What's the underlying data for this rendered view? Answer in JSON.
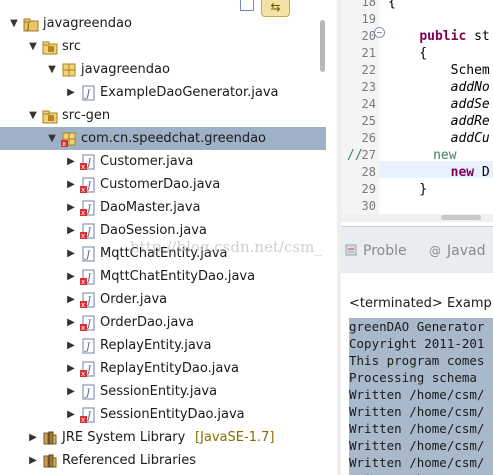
{
  "explorer": {
    "toolbar": {
      "collapse_icon": "collapse-all-icon",
      "link_icon": "link-with-editor-icon"
    },
    "rows": [
      {
        "label": "javagreendao",
        "icon": "java-project-icon",
        "twisty": "▼"
      },
      {
        "label": "src",
        "icon": "source-folder-icon",
        "twisty": "▼"
      },
      {
        "label": "javagreendao",
        "icon": "package-icon",
        "twisty": "▼"
      },
      {
        "label": "ExampleDaoGenerator.java",
        "icon": "java-file-icon",
        "twisty": "▶"
      },
      {
        "label": "src-gen",
        "icon": "source-folder-icon",
        "twisty": "▼"
      },
      {
        "label": "com.cn.speedchat.greendao",
        "icon": "package-error-icon",
        "twisty": "▼"
      },
      {
        "label": "Customer.java",
        "icon": "java-file-error-icon",
        "twisty": "▶"
      },
      {
        "label": "CustomerDao.java",
        "icon": "java-file-error-icon",
        "twisty": "▶"
      },
      {
        "label": "DaoMaster.java",
        "icon": "java-file-error-icon",
        "twisty": "▶"
      },
      {
        "label": "DaoSession.java",
        "icon": "java-file-error-icon",
        "twisty": "▶"
      },
      {
        "label": "MqttChatEntity.java",
        "icon": "java-file-icon",
        "twisty": "▶"
      },
      {
        "label": "MqttChatEntityDao.java",
        "icon": "java-file-error-icon",
        "twisty": "▶"
      },
      {
        "label": "Order.java",
        "icon": "java-file-error-icon",
        "twisty": "▶"
      },
      {
        "label": "OrderDao.java",
        "icon": "java-file-error-icon",
        "twisty": "▶"
      },
      {
        "label": "ReplayEntity.java",
        "icon": "java-file-icon",
        "twisty": "▶"
      },
      {
        "label": "ReplayEntityDao.java",
        "icon": "java-file-error-icon",
        "twisty": "▶"
      },
      {
        "label": "SessionEntity.java",
        "icon": "java-file-icon",
        "twisty": "▶"
      },
      {
        "label": "SessionEntityDao.java",
        "icon": "java-file-error-icon",
        "twisty": "▶"
      },
      {
        "label": "JRE System Library",
        "decoration": "[JavaSE-1.7]",
        "icon": "library-icon",
        "twisty": "▶"
      },
      {
        "label": "Referenced Libraries",
        "icon": "library-icon",
        "twisty": "▶"
      }
    ]
  },
  "editor": {
    "lines": [
      {
        "num": "18",
        "text": "{"
      },
      {
        "num": "19",
        "text": ""
      },
      {
        "num": "20",
        "kw": "public",
        "text": " st"
      },
      {
        "num": "21",
        "text": "    {"
      },
      {
        "num": "22",
        "text": "        Schem"
      },
      {
        "num": "23",
        "text": "        addNo",
        "italic": true
      },
      {
        "num": "24",
        "text": "        addSe",
        "italic": true
      },
      {
        "num": "25",
        "text": "        addRe",
        "italic": true
      },
      {
        "num": "26",
        "text": "        addCu",
        "italic": true
      },
      {
        "num": "27",
        "comment": "//",
        "text": "         new"
      },
      {
        "num": "28",
        "kw": "new",
        "text": " D"
      },
      {
        "num": "29",
        "text": "    }"
      },
      {
        "num": "30",
        "text": ""
      }
    ]
  },
  "bottom": {
    "tabs": [
      {
        "label": "Proble",
        "icon": "problems-icon"
      },
      {
        "label": "Javad",
        "icon": "javadoc-icon",
        "prefix": "@"
      }
    ],
    "console_title": "<terminated> Exampl",
    "console_lines": [
      "greenDAO Generator",
      "Copyright 2011-201",
      "This program comes",
      "Processing schema",
      "Written /home/csm/",
      "Written /home/csm/",
      "Written /home/csm/",
      "Written /home/csm/",
      "Written /home/csm/",
      "Written /home/csm/"
    ]
  },
  "watermark": "http://blog.csdn.net/csm_"
}
